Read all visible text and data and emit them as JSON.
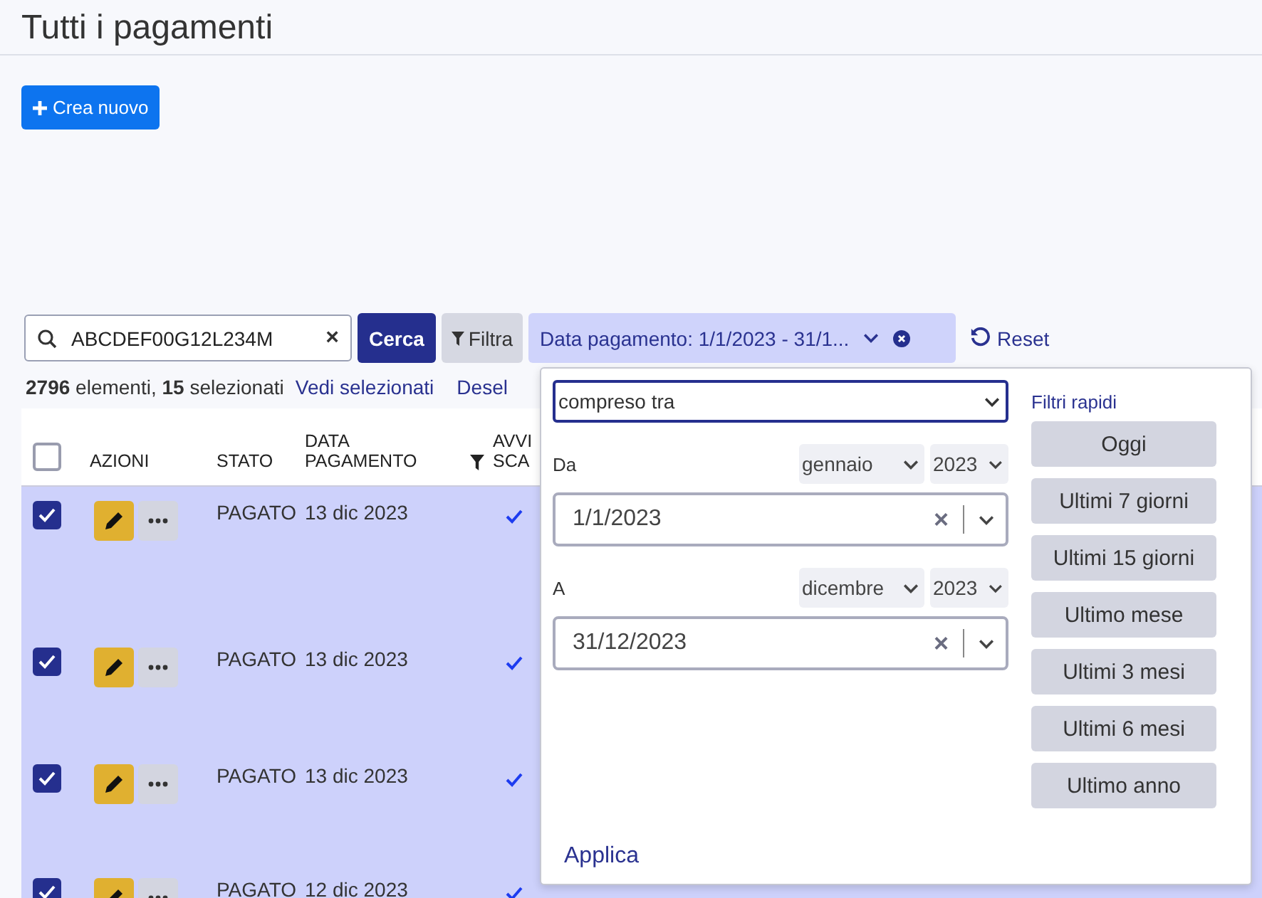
{
  "title": "Tutti i pagamenti",
  "create_button": "Crea nuovo",
  "search": {
    "value": "ABCDEF00G12L234M",
    "clear": "×"
  },
  "search_button": "Cerca",
  "filter_button": "Filtra",
  "active_filter": {
    "label": "Data pagamento: 1/1/2023 - 31/1...",
    "expanded": true
  },
  "reset_button": "Reset",
  "summary": {
    "count": "2796",
    "count_label": "elementi,",
    "selected": "15",
    "selected_label": "selezionati",
    "view_selected": "Vedi selezionati",
    "deselect": "Desel"
  },
  "table": {
    "all_selected": false,
    "columns": [
      {
        "label": "AZIONI"
      },
      {
        "label": "STATO"
      },
      {
        "label": "DATA PAGAMENTO",
        "filtered": true
      },
      {
        "label": "AVVI SCA"
      }
    ],
    "rows": [
      {
        "selected": true,
        "status": "PAGATO",
        "date": "13 dic 2023",
        "notified": true
      },
      {
        "selected": true,
        "status": "PAGATO",
        "date": "13 dic 2023",
        "notified": true
      },
      {
        "selected": true,
        "status": "PAGATO",
        "date": "13 dic 2023",
        "notified": true
      },
      {
        "selected": true,
        "status": "PAGATO",
        "date": "12 dic 2023",
        "notified": true
      }
    ]
  },
  "popup": {
    "operator": "compreso tra",
    "from": {
      "label": "Da",
      "month": "gennaio",
      "year": "2023",
      "value": "1/1/2023",
      "clear": "×"
    },
    "to": {
      "label": "A",
      "month": "dicembre",
      "year": "2023",
      "value": "31/12/2023",
      "clear": "×"
    },
    "quick_title": "Filtri rapidi",
    "quick_filters": [
      "Oggi",
      "Ultimi 7 giorni",
      "Ultimi 15 giorni",
      "Ultimo mese",
      "Ultimi 3 mesi",
      "Ultimi 6 mesi",
      "Ultimo anno"
    ],
    "apply": "Applica"
  }
}
